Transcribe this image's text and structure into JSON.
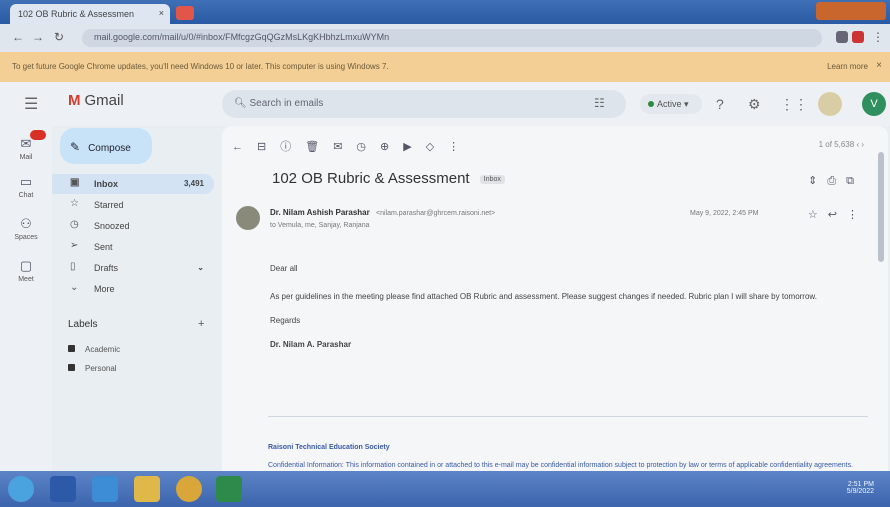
{
  "browser": {
    "tab_title": "102 OB Rubric & Assessmen",
    "tab_close": "×",
    "url": "mail.google.com/mail/u/0/#inbox/FMfcgzGqQGzMsLKgKHbhzLmxuWYMn",
    "notice_text": "To get future Google Chrome updates, you'll need Windows 10 or later. This computer is using Windows 7.",
    "notice_link": "Learn more",
    "notice_close": "×"
  },
  "gmail": {
    "app_name": "Gmail",
    "search_placeholder": "Search in emails",
    "status": "Active",
    "user_initial": "V"
  },
  "rail": [
    {
      "label": "Mail",
      "icon": "mail-icon"
    },
    {
      "label": "Chat",
      "icon": "chat-icon"
    },
    {
      "label": "Spaces",
      "icon": "spaces-icon"
    },
    {
      "label": "Meet",
      "icon": "meet-icon"
    }
  ],
  "nav": {
    "compose": "Compose",
    "items": [
      {
        "label": "Inbox",
        "count": "3,491"
      },
      {
        "label": "Starred",
        "count": ""
      },
      {
        "label": "Snoozed",
        "count": ""
      },
      {
        "label": "Sent",
        "count": ""
      },
      {
        "label": "Drafts",
        "count": ""
      },
      {
        "label": "More",
        "count": ""
      }
    ],
    "labels_title": "Labels",
    "labels": [
      "Academic",
      "Personal"
    ]
  },
  "message": {
    "subject": "102 OB Rubric & Assessment",
    "inbox_tag": "Inbox",
    "pager": "1 of 5,638",
    "sender_name": "Dr. Nilam Ashish Parashar",
    "sender_email": "<nilam.parashar@ghrcem.raisoni.net>",
    "to": "to Vemula, me, Sanjay, Ranjana",
    "date": "May 9, 2022, 2:45 PM",
    "greeting": "Dear all",
    "body": "As per guidelines in the meeting please find attached OB Rubric and assessment. Please suggest changes if needed. Rubric plan I will share by tomorrow.",
    "regards": "Regards",
    "signature": "Dr. Nilam A. Parashar",
    "footer_org": "Raisoni Technical Education Society",
    "footer_disclaimer": "Confidential Information: This information contained in or attached to this e-mail may be confidential information subject to protection by law or terms of applicable confidentiality agreements."
  },
  "taskbar": {
    "time": "2:51 PM",
    "date": "5/9/2022"
  }
}
